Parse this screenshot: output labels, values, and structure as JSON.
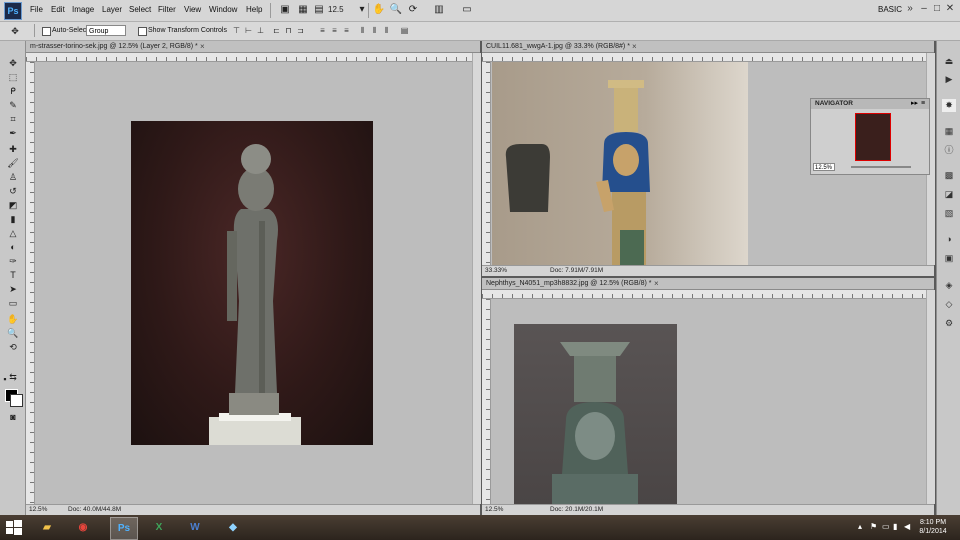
{
  "app": {
    "logo": "Ps",
    "workspace": "BASIC",
    "zoom_value": "12.5"
  },
  "menu": [
    "File",
    "Edit",
    "Image",
    "Layer",
    "Select",
    "Filter",
    "View",
    "Window",
    "Help"
  ],
  "options": {
    "auto_select_label": "Auto-Select:",
    "auto_select_value": "Group",
    "transform_label": "Show Transform Controls"
  },
  "docs": [
    {
      "tab": "m-strasser-torino-sek.jpg @ 12.5% (Layer 2, RGB/8) *",
      "zoom": "12.5%",
      "doc": "Doc: 40.0M/44.8M"
    },
    {
      "tab": "CUIL11.681_wwgA-1.jpg @ 33.3% (RGB/8#) *",
      "zoom": "33.33%",
      "doc": "Doc: 7.91M/7.91M"
    },
    {
      "tab": "Nephthys_N4051_mp3h8832.jpg @ 12.5% (RGB/8) *",
      "zoom": "12.5%",
      "doc": "Doc: 20.1M/20.1M"
    }
  ],
  "navigator": {
    "title": "NAVIGATOR",
    "zoom": "12.5%"
  },
  "taskbar": {
    "time": "8:10 PM",
    "date": "8/1/2014"
  },
  "colors": {
    "menubar": "#d6d6d6",
    "canvas": "#bdbdbd",
    "taskbar": "#2c241d",
    "accent": "#1b2a4a"
  }
}
